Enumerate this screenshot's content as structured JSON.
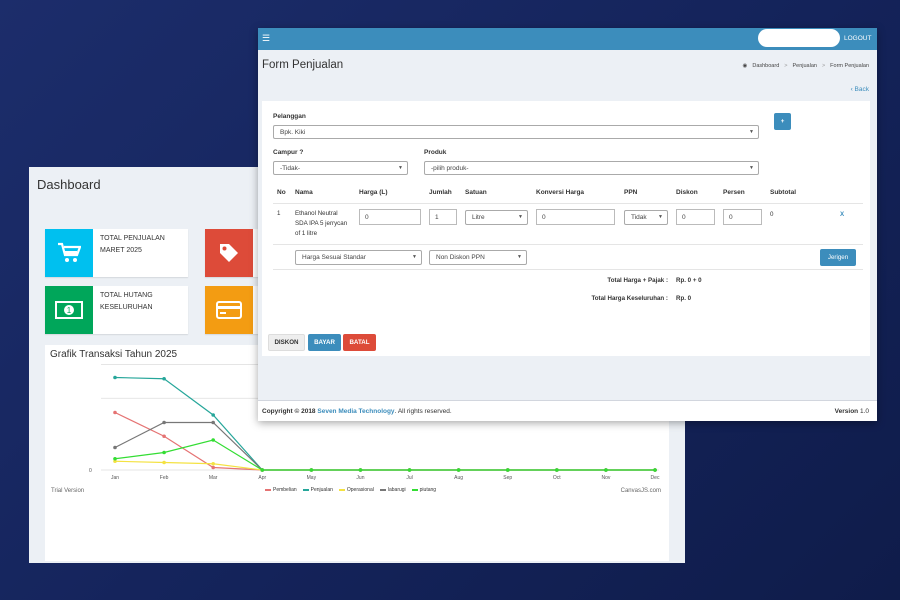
{
  "dashboard": {
    "title": "Dashboard",
    "cards": [
      {
        "line1": "TOTAL PENJUALAN",
        "line2": "MARET 2025",
        "color": "#00c0ef",
        "icon": "cart-icon"
      },
      {
        "line1": "TOTAL HUTANG",
        "line2": "KESELURUHAN",
        "color": "#00a65a",
        "icon": "money-icon"
      },
      {
        "line1": "",
        "line2": "",
        "color": "#dd4b39",
        "icon": "tag-icon"
      },
      {
        "line1": "",
        "line2": "",
        "color": "#f39c12",
        "icon": "credit-card-icon"
      }
    ],
    "chart_title": "Grafik Transaksi Tahun 2025",
    "trial_text": "Trial Version",
    "canvasjs_text": "CanvasJS.com"
  },
  "chart_data": {
    "type": "line",
    "title": "Grafik Transaksi Tahun 2025",
    "categories": [
      "Jan",
      "Feb",
      "Mar",
      "Apr",
      "May",
      "Jun",
      "Jul",
      "Aug",
      "Sep",
      "Oct",
      "Nov",
      "Dec"
    ],
    "y_zero_label": "0",
    "series": [
      {
        "name": "Pembelian",
        "color": "#e57373",
        "values": [
          46,
          27,
          2,
          0,
          0,
          0,
          0,
          0,
          0,
          0,
          0,
          0
        ]
      },
      {
        "name": "Penjualan",
        "color": "#26a69a",
        "values": [
          74,
          73,
          44,
          0,
          0,
          0,
          0,
          0,
          0,
          0,
          0,
          0
        ]
      },
      {
        "name": "Operasional",
        "color": "#f4e242",
        "values": [
          7,
          6,
          5,
          0,
          0,
          0,
          0,
          0,
          0,
          0,
          0,
          0
        ]
      },
      {
        "name": "labarugi",
        "color": "#777777",
        "values": [
          18,
          38,
          38,
          0,
          0,
          0,
          0,
          0,
          0,
          0,
          0,
          0
        ]
      },
      {
        "name": "piutang",
        "color": "#33dd33",
        "values": [
          9,
          14,
          24,
          0,
          0,
          0,
          0,
          0,
          0,
          0,
          0,
          0
        ]
      }
    ],
    "legend": "bottom",
    "grid": true
  },
  "form": {
    "menu_icon": "hamburger-icon",
    "logout": "LOGOUT",
    "title": "Form Penjualan",
    "breadcrumb": [
      "Dashboard",
      "Penjualan",
      "Form Penjualan"
    ],
    "back": "Back",
    "pelanggan_label": "Pelanggan",
    "pelanggan_value": "Bpk. Kiki",
    "add_button": "+",
    "campur_label": "Campur ?",
    "campur_value": "-Tidak-",
    "produk_label": "Produk",
    "produk_value": "-pilih produk-",
    "table": {
      "headers": [
        "No",
        "Nama",
        "Harga (L)",
        "Jumlah",
        "Satuan",
        "Konversi Harga",
        "PPN",
        "Diskon",
        "Persen",
        "Subtotal"
      ],
      "row": {
        "no": "1",
        "nama": [
          "Ethanol Neutral",
          "SDA IPA 5 jerrycan",
          "of 1 litre"
        ],
        "harga": "0",
        "jumlah": "1",
        "satuan": "Litre",
        "konversi": "0",
        "ppn": "Tidak",
        "diskon": "0",
        "persen": "0",
        "subtotal": "0",
        "remove": "X"
      }
    },
    "harga_select": "Harga Sesuai Standar",
    "ppn_select": "Non Diskon PPN",
    "jerigen_button": "Jerigen",
    "total_pajak_label": "Total Harga + Pajak :",
    "total_pajak_value": "Rp. 0 + 0",
    "total_all_label": "Total Harga Keseluruhan :",
    "total_all_value": "Rp. 0",
    "buttons": {
      "diskon": "DISKON",
      "bayar": "BAYAR",
      "batal": "BATAL"
    },
    "footer_copyright": "Copyright © 2018",
    "footer_brand": "Seven Media Technology",
    "footer_rights": ". All rights reserved.",
    "version_label": "Version",
    "version_value": "1.0"
  }
}
